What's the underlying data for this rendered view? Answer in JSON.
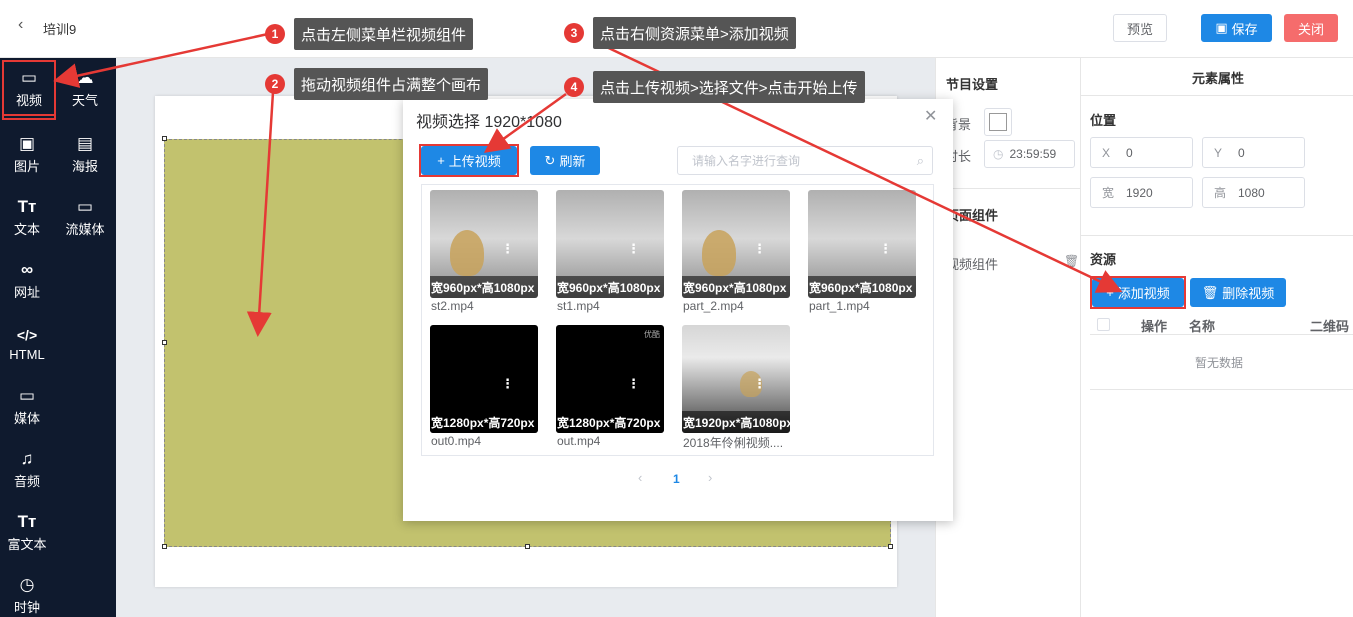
{
  "header": {
    "back_icon": "chevron-left-icon",
    "title": "培训9",
    "preview_label": "预览",
    "save_label": "保存",
    "close_label": "关闭"
  },
  "sidebar": {
    "items": [
      {
        "label": "视频",
        "icon": "video-icon",
        "glyph": "▭"
      },
      {
        "label": "天气",
        "icon": "cloud-icon",
        "glyph": "☁"
      },
      {
        "label": "图片",
        "icon": "image-icon",
        "glyph": "▣"
      },
      {
        "label": "海报",
        "icon": "poster-icon",
        "glyph": "▤"
      },
      {
        "label": "文本",
        "icon": "text-icon",
        "glyph": "Tт"
      },
      {
        "label": "流媒体",
        "icon": "stream-icon",
        "glyph": "▭"
      },
      {
        "label": "网址",
        "icon": "link-icon",
        "glyph": "∞"
      },
      {
        "label": "HTML",
        "icon": "code-icon",
        "glyph": "</>"
      },
      {
        "label": "媒体",
        "icon": "media-icon",
        "glyph": "▭"
      },
      {
        "label": "音频",
        "icon": "music-icon",
        "glyph": "♫"
      },
      {
        "label": "富文本",
        "icon": "rich-text-icon",
        "glyph": "Tт"
      },
      {
        "label": "时钟",
        "icon": "clock-icon",
        "glyph": "◷"
      }
    ]
  },
  "program_settings": {
    "title": "节目设置",
    "background_label": "背景",
    "duration_label": "时长",
    "duration_value": "23:59:59",
    "page_components_title": "页面组件",
    "component_item": "视频组件"
  },
  "element_props": {
    "title": "元素属性",
    "position_label": "位置",
    "x_label": "X",
    "x_value": "0",
    "y_label": "Y",
    "y_value": "0",
    "w_label": "宽",
    "w_value": "1920",
    "h_label": "高",
    "h_value": "1080",
    "resources_label": "资源",
    "add_video_label": "添加视频",
    "delete_video_label": "删除视频",
    "col_action": "操作",
    "col_name": "名称",
    "col_qr": "二维码",
    "empty_text": "暂无数据"
  },
  "dialog": {
    "title": "视频选择 1920*1080",
    "upload_label": "上传视频",
    "refresh_label": "刷新",
    "search_placeholder": "请输入名字进行查询",
    "videos": [
      {
        "name": "st2.mp4",
        "res": "宽960px*高1080px"
      },
      {
        "name": "st1.mp4",
        "res": "宽960px*高1080px"
      },
      {
        "name": "part_2.mp4",
        "res": "宽960px*高1080px"
      },
      {
        "name": "part_1.mp4",
        "res": "宽960px*高1080px"
      },
      {
        "name": "out0.mp4",
        "res": "宽1280px*高720px"
      },
      {
        "name": "out.mp4",
        "res": "宽1280px*高720px"
      },
      {
        "name": "2018年伶俐视频....",
        "res": "宽1920px*高1080px"
      }
    ],
    "watermark": "优酷",
    "page": "1"
  },
  "annotations": [
    {
      "num": "1",
      "text": "点击左侧菜单栏视频组件"
    },
    {
      "num": "2",
      "text": "拖动视频组件占满整个画布"
    },
    {
      "num": "3",
      "text": "点击右侧资源菜单>添加视频"
    },
    {
      "num": "4",
      "text": "点击上传视频>选择文件>点击开始上传"
    }
  ],
  "colors": {
    "accent": "#1e88e5",
    "danger": "#f56c6c",
    "annotation_red": "#e53935",
    "sidebar_bg": "#0f1a2e",
    "video_component": "#c2c26e"
  }
}
